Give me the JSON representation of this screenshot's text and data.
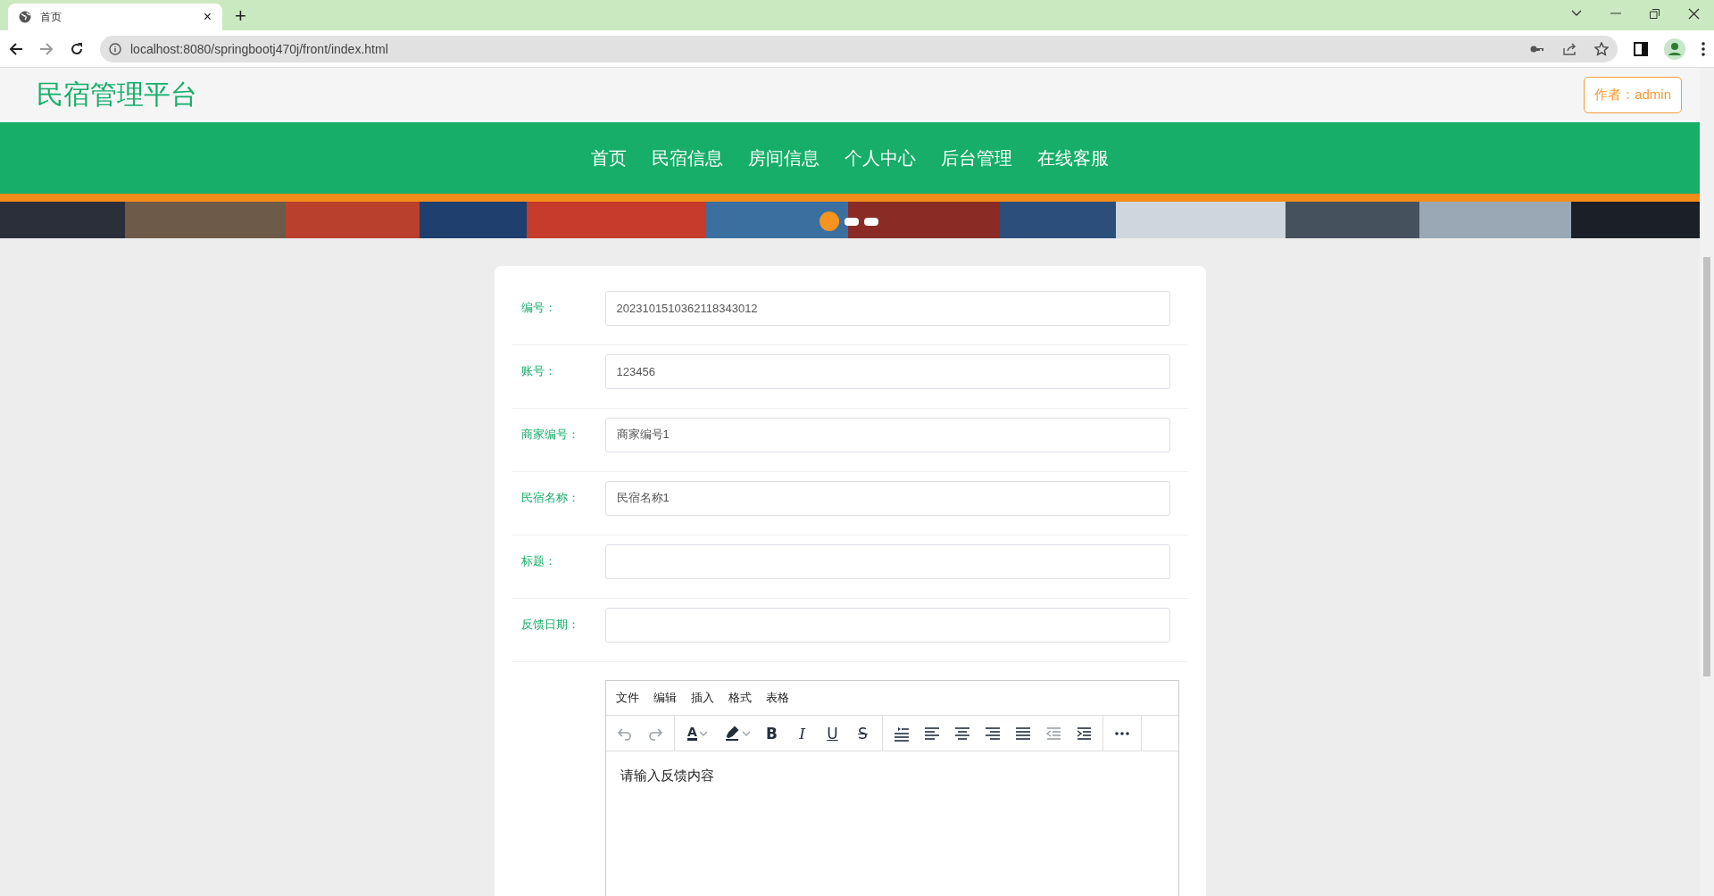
{
  "browser": {
    "tab": {
      "title": "首页",
      "close": "×"
    },
    "new_tab": "+",
    "url": "localhost:8080/springbootj470j/front/index.html"
  },
  "header": {
    "title": "民宿管理平台",
    "author_button": "作者：admin"
  },
  "nav": [
    "首页",
    "民宿信息",
    "房间信息",
    "个人中心",
    "后台管理",
    "在线客服"
  ],
  "banner": {
    "dots": [
      {
        "selected": true
      },
      {
        "selected": false
      },
      {
        "selected": false
      }
    ]
  },
  "form": {
    "fields": [
      {
        "label": "编号：",
        "value": "2023101510362118343012"
      },
      {
        "label": "账号：",
        "value": "123456"
      },
      {
        "label": "商家编号：",
        "value": "商家编号1"
      },
      {
        "label": "民宿名称：",
        "value": "民宿名称1"
      },
      {
        "label": "标题："
      },
      {
        "label": "反馈日期："
      }
    ],
    "editor": {
      "menu": [
        "文件",
        "编辑",
        "插入",
        "格式",
        "表格"
      ],
      "toolbar": [
        [
          {
            "kind": "undo",
            "disabled": true
          },
          {
            "kind": "redo",
            "disabled": true
          }
        ],
        [
          {
            "kind": "forecolor",
            "glyph": "A",
            "disabled": false
          },
          {
            "kind": "backcolor",
            "disabled": false
          },
          {
            "kind": "bold",
            "glyph": "B",
            "disabled": false
          },
          {
            "kind": "italic",
            "glyph": "I",
            "disabled": false
          },
          {
            "kind": "underline",
            "glyph": "U",
            "disabled": false
          },
          {
            "kind": "strike",
            "glyph": "S",
            "disabled": false
          }
        ],
        [
          {
            "kind": "lineheight",
            "disabled": false
          },
          {
            "kind": "alignleft",
            "disabled": false
          },
          {
            "kind": "aligncenter",
            "disabled": false
          },
          {
            "kind": "alignright",
            "disabled": false
          },
          {
            "kind": "justify",
            "disabled": false
          },
          {
            "kind": "outdent",
            "disabled": true
          },
          {
            "kind": "indent",
            "disabled": false
          }
        ],
        [
          {
            "kind": "more",
            "disabled": false
          }
        ]
      ],
      "placeholder": "请输入反馈内容"
    }
  }
}
